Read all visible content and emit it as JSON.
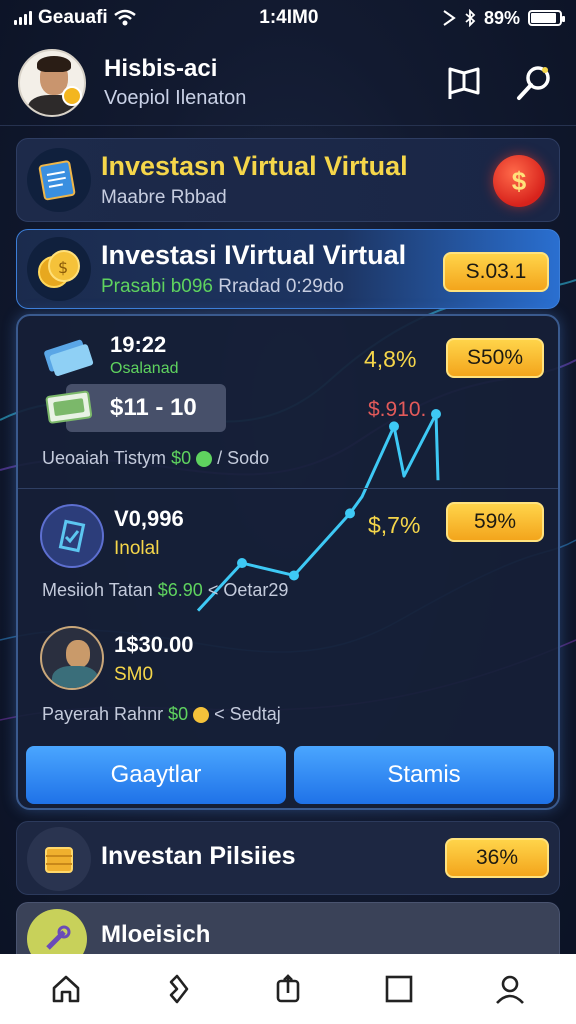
{
  "status": {
    "carrier": "Geauafi",
    "time": "1:4ΙΜ0",
    "battery": "89%"
  },
  "header": {
    "name": "Hisbis-aci",
    "subtitle": "Voepiol Ilenaton"
  },
  "card1": {
    "title": "Investasn Virtual Virtual",
    "subtitle": "Maabre Rbbad",
    "badge": "$"
  },
  "card2": {
    "title": "Investasi IVirtual Virtual",
    "sub_green": "Prasabi b096",
    "sub_gray": "Rradad 0:29do",
    "value": "S.03.1"
  },
  "panel": {
    "row1": {
      "time": "19:22",
      "label": "Osalanad",
      "chip": "$11 - 10",
      "pct": "4,8%",
      "pill": "S50%",
      "red_value": "$.910.",
      "footer_gray": "Ueoaiah Tistym",
      "footer_green": "$0",
      "footer_tail": "/ Sodo"
    },
    "row2": {
      "value": "V0,996",
      "label": "Inolal",
      "pct": "$,7%",
      "pill": "59%",
      "footer_gray": "Mesiioh Tatan",
      "footer_green": "$6.90",
      "footer_tail": "< Oetar29"
    },
    "row3": {
      "value": "1$30.00",
      "label": "SM0",
      "footer_gray": "Payerah Rahnr",
      "footer_green": "$0",
      "footer_tail": "< Sedtaj"
    },
    "buttons": {
      "left": "Gaaytlar",
      "right": "Stamis"
    },
    "chart_line": [
      0.05,
      0.28,
      0.22,
      0.52,
      0.6,
      0.94,
      0.7,
      1.0,
      0.68
    ]
  },
  "card3": {
    "title": "Investan Pilsiies",
    "value": "36%"
  },
  "card4": {
    "title": "Mloeisich"
  },
  "colors": {
    "accent_yellow": "#f5d64a",
    "accent_green": "#5fd35f",
    "button_blue": "#2f8cf4",
    "chart_line": "#3ec9f5"
  }
}
